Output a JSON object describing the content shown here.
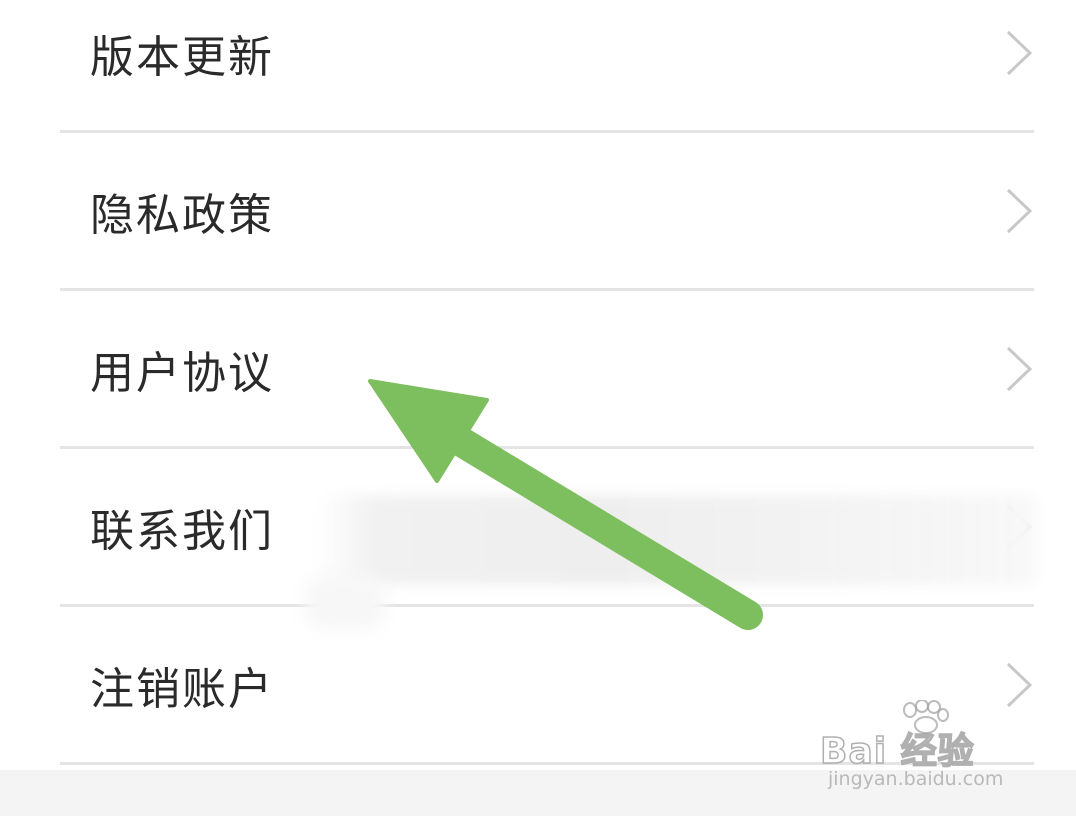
{
  "settings_menu": {
    "items": [
      {
        "label": "版本更新",
        "chevron": "chevron-right-icon"
      },
      {
        "label": "隐私政策",
        "chevron": "chevron-right-icon"
      },
      {
        "label": "用户协议",
        "chevron": "chevron-right-icon"
      },
      {
        "label": "联系我们",
        "chevron": "chevron-right-icon"
      },
      {
        "label": "注销账户",
        "chevron": "chevron-right-icon"
      }
    ]
  },
  "annotation": {
    "arrow_color": "#7dbf5e",
    "arrow_icon": "arrow-up-left-icon"
  },
  "watermark": {
    "brand": "Bai  经验",
    "url": "jingyan.baidu.com",
    "icon": "paw-icon"
  },
  "colors": {
    "text": "#2a2a2a",
    "divider": "#e4e4e4",
    "chevron": "#c8c8c8",
    "background": "#ffffff"
  }
}
